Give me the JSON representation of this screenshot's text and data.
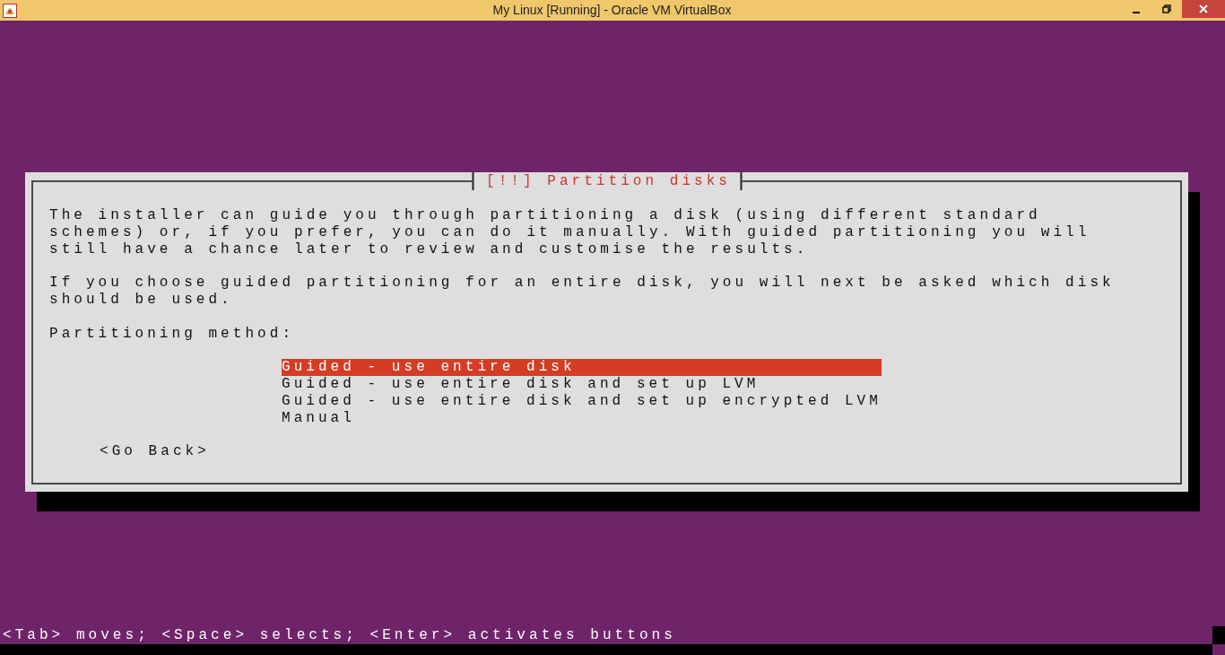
{
  "window": {
    "title": "My Linux [Running] - Oracle VM VirtualBox"
  },
  "dialog": {
    "title": "[!!] Partition disks",
    "paragraphs": [
      "The installer can guide you through partitioning a disk (using different standard\nschemes) or, if you prefer, you can do it manually. With guided partitioning you will\nstill have a chance later to review and customise the results.",
      "If you choose guided partitioning for an entire disk, you will next be asked which disk\nshould be used."
    ],
    "prompt": "Partitioning method:",
    "options": [
      {
        "label": "Guided - use entire disk",
        "selected": true
      },
      {
        "label": "Guided - use entire disk and set up LVM",
        "selected": false
      },
      {
        "label": "Guided - use entire disk and set up encrypted LVM",
        "selected": false
      },
      {
        "label": "Manual",
        "selected": false
      }
    ],
    "back_button": "<Go Back>"
  },
  "status_line": "<Tab> moves; <Space> selects; <Enter> activates buttons"
}
